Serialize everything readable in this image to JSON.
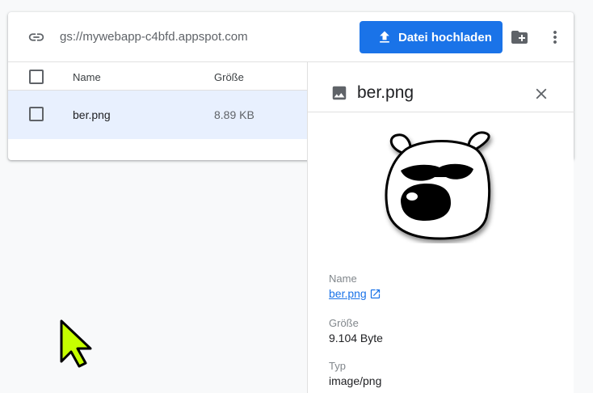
{
  "topbar": {
    "bucket_path": "gs://mywebapp-c4bfd.appspot.com",
    "upload_label": "Datei hochladen",
    "accent_color": "#1a73e8"
  },
  "table": {
    "columns": [
      "Name",
      "Größe"
    ],
    "rows": [
      {
        "name": "ber.png",
        "size": "8.89 KB",
        "selected": true
      }
    ],
    "selected_row_color": "#e8f0fe"
  },
  "details": {
    "title": "ber.png",
    "fields": {
      "name_label": "Name",
      "name_value": "ber.png",
      "size_label": "Größe",
      "size_value": "9.104 Byte",
      "type_label": "Typ",
      "type_value": "image/png"
    }
  },
  "icons": [
    "link-icon",
    "upload-icon",
    "new-folder-icon",
    "more-vert-icon",
    "image-icon",
    "close-icon",
    "open-in-new-icon",
    "mouse-cursor-icon"
  ]
}
